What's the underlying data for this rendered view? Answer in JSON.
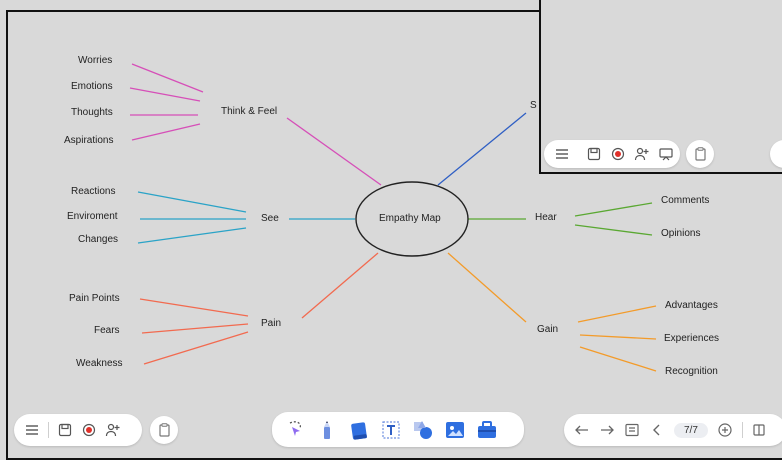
{
  "mindmap": {
    "center": "Empathy Map",
    "branches": {
      "think_feel": {
        "label": "Think & Feel",
        "items": [
          "Worries",
          "Emotions",
          "Thoughts",
          "Aspirations"
        ]
      },
      "see": {
        "label": "See",
        "items": [
          "Reactions",
          "Enviroment",
          "Changes"
        ]
      },
      "pain": {
        "label": "Pain",
        "items": [
          "Pain Points",
          "Fears",
          "Weakness"
        ]
      },
      "hear": {
        "label": "Hear",
        "items": [
          "Comments",
          "Opinions"
        ]
      },
      "gain": {
        "label": "Gain",
        "items": [
          "Advantages",
          "Experiences",
          "Recognition"
        ]
      },
      "say": {
        "label": "S"
      }
    }
  },
  "colors": {
    "think_feel": "#d64fb8",
    "see": "#2aa3c7",
    "pain": "#f26a4f",
    "hear": "#5aa832",
    "gain": "#f39b2a",
    "say": "#2f5fc4"
  },
  "toolbar": {
    "page_indicator": "7/7",
    "left_icons": [
      "menu-icon",
      "save-icon",
      "record-icon",
      "add-user-icon"
    ],
    "inset_icons": [
      "menu-icon",
      "save-icon",
      "record-icon",
      "add-user-icon",
      "present-icon"
    ],
    "tools": [
      "lasso-select-icon",
      "pen-icon",
      "eraser-icon",
      "text-icon",
      "shapes-icon",
      "image-icon",
      "toolbox-icon"
    ],
    "nav_icons": [
      "undo-icon",
      "redo-icon",
      "pages-icon",
      "prev-page-icon",
      "add-page-icon",
      "panel-icon"
    ]
  }
}
